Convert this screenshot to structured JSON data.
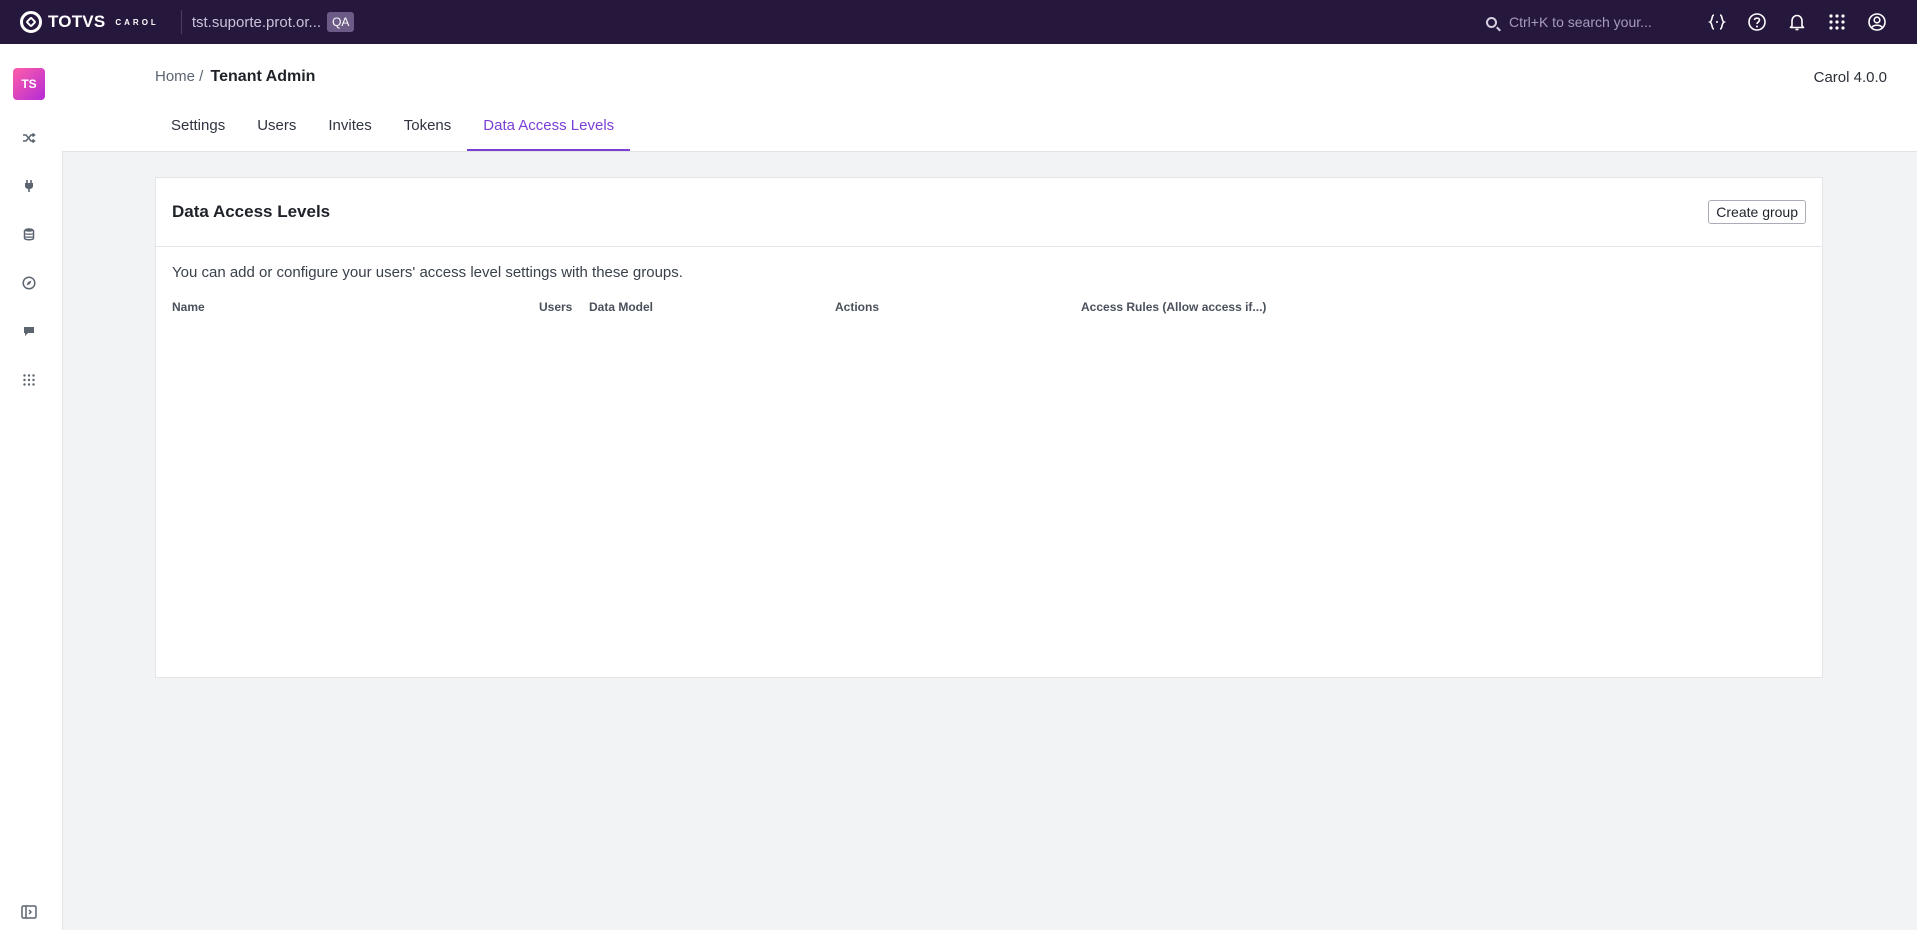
{
  "topbar": {
    "logo_word": "TOTVS",
    "logo_sub": "CAROL",
    "tenant": "tst.suporte.prot.or...",
    "env_badge": "QA",
    "search_placeholder": "Ctrl+K to search your..."
  },
  "sidebar": {
    "avatar_initials": "TS",
    "icons": [
      "shuffle-icon",
      "plug-icon",
      "database-icon",
      "compass-icon",
      "chat-icon",
      "apps-grid-icon"
    ]
  },
  "header": {
    "breadcrumb_home": "Home /",
    "breadcrumb_current": "Tenant Admin",
    "version": "Carol 4.0.0",
    "tabs": [
      {
        "label": "Settings",
        "active": false
      },
      {
        "label": "Users",
        "active": false
      },
      {
        "label": "Invites",
        "active": false
      },
      {
        "label": "Tokens",
        "active": false
      },
      {
        "label": "Data Access Levels",
        "active": true
      }
    ]
  },
  "card": {
    "title": "Data Access Levels",
    "create_label": "Create group",
    "description": "You can add or configure your users' access level settings with these groups.",
    "columns": [
      "Name",
      "Users",
      "Data Model",
      "Actions",
      "Access Rules (Allow access if...)"
    ]
  },
  "colors": {
    "topbar": "#26173d",
    "accent": "#7b3fd4",
    "background": "#f2f3f5"
  }
}
